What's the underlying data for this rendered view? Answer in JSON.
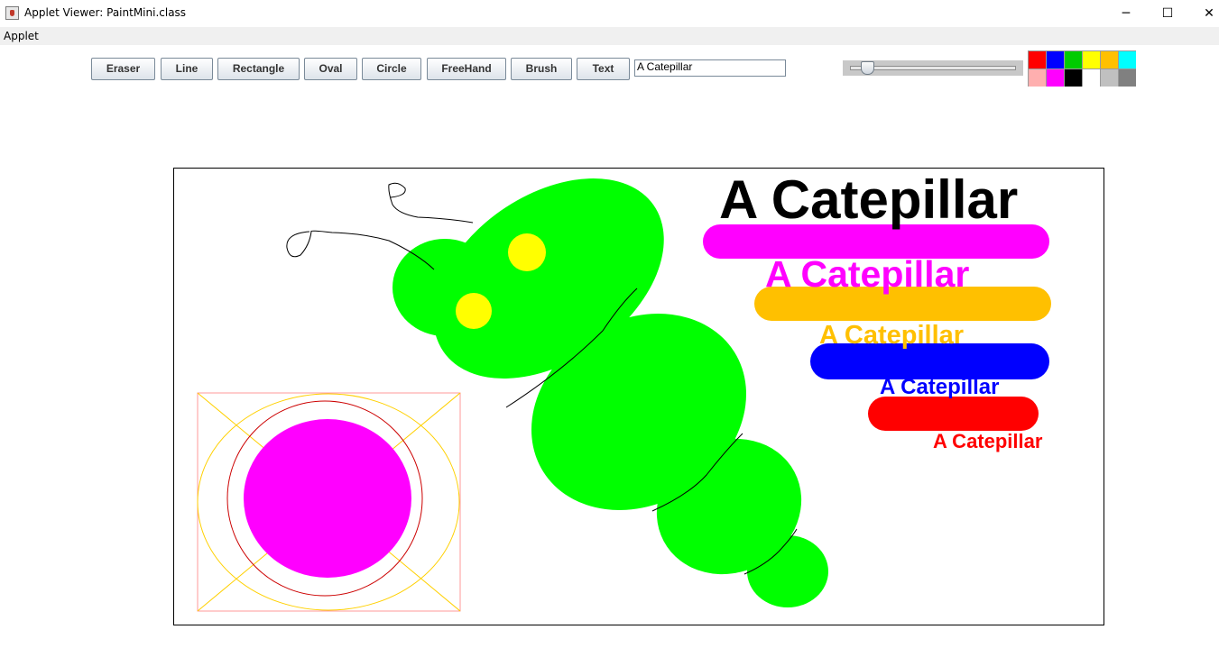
{
  "window": {
    "title": "Applet Viewer: PaintMini.class",
    "minimize": "─",
    "maximize": "☐",
    "close": "✕"
  },
  "menu": {
    "applet": "Applet"
  },
  "toolbar": {
    "buttons": [
      "Eraser",
      "Line",
      "Rectangle",
      "Oval",
      "Circle",
      "FreeHand",
      "Brush",
      "Text"
    ],
    "text_value": "A Catepillar"
  },
  "slider": {
    "value_fraction": 0.07
  },
  "palette": {
    "colors": [
      "#ff0000",
      "#0000ff",
      "#00cc00",
      "#ffff00",
      "#ffc000",
      "#00ffff",
      "#ffafaf",
      "#ff00ff",
      "#000000",
      "#ffffff",
      "#c0c0c0",
      "#808080"
    ]
  },
  "canvas": {
    "texts": [
      {
        "text": "A Catepillar",
        "color": "#000000"
      },
      {
        "text": "A Catepillar",
        "color": "#ff00ff"
      },
      {
        "text": "A Catepillar",
        "color": "#ffc000"
      },
      {
        "text": "A Catepillar",
        "color": "#0000ff"
      },
      {
        "text": "A Catepillar",
        "color": "#ff0000"
      }
    ],
    "colors": {
      "body": "#00ff00",
      "eyes": "#ffff00",
      "ball": "#ff00ff",
      "rect_outline": "#ff9999",
      "oval_outline": "#ffd000",
      "circle_outline": "#cc0000"
    }
  }
}
